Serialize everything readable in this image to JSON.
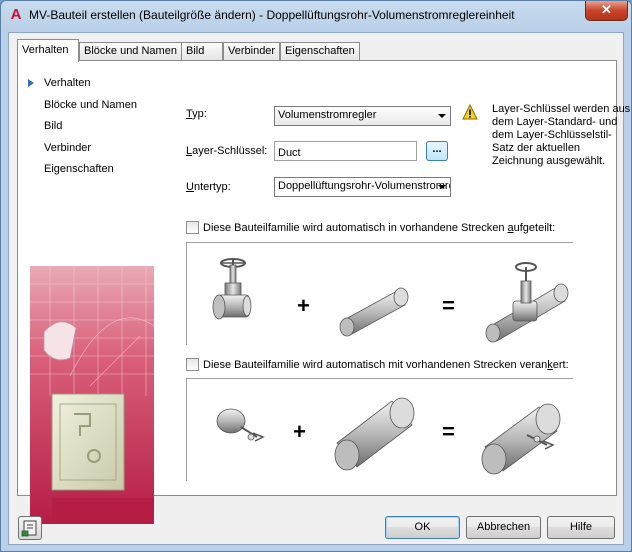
{
  "window": {
    "title": "MV-Bauteil erstellen (Bauteilgröße ändern) - Doppellüftungsrohr-Volumenstromreglereinheit",
    "close_label": "✕",
    "app_icon": "autocad-a-icon"
  },
  "tabs": [
    {
      "label": "Verhalten",
      "active": true
    },
    {
      "label": "Blöcke und Namen",
      "active": false
    },
    {
      "label": "Bild",
      "active": false
    },
    {
      "label": "Verbinder",
      "active": false
    },
    {
      "label": "Eigenschaften",
      "active": false
    }
  ],
  "nav": {
    "items": [
      {
        "label": "Verhalten",
        "current": true
      },
      {
        "label": "Blöcke und Namen",
        "current": false
      },
      {
        "label": "Bild",
        "current": false
      },
      {
        "label": "Verbinder",
        "current": false
      },
      {
        "label": "Eigenschaften",
        "current": false
      }
    ]
  },
  "form": {
    "typ_label_pre": "",
    "typ_label_mn": "T",
    "typ_label_post": "yp:",
    "typ_value": "Volumenstromregler",
    "layer_label_pre": "",
    "layer_label_mn": "L",
    "layer_label_post": "ayer-Schlüssel:",
    "layer_value": "Duct",
    "browse_label": "...",
    "untertyp_label_pre": "",
    "untertyp_label_mn": "U",
    "untertyp_label_post": "ntertyp:",
    "untertyp_value": "Doppellüftungsrohr-Volumenstromregler"
  },
  "info": {
    "icon": "warning-icon",
    "text": "Layer-Schlüssel werden aus dem Layer-Standard- und dem Layer-Schlüsselstil-Satz der aktuellen Zeichnung ausgewählt."
  },
  "options": {
    "split_pre": "Diese Bauteilfamilie wird automatisch in vorhandene Strecken ",
    "split_mn": "a",
    "split_post": "ufgeteilt:",
    "split_checked": false,
    "anchor_pre": "Diese Bauteilfamilie wird automatisch mit vorhandenen Strecken veran",
    "anchor_mn": "k",
    "anchor_post": "ert:",
    "anchor_checked": false
  },
  "equation": {
    "plus": "+",
    "equals": "="
  },
  "buttons": {
    "ok": "OK",
    "cancel": "Abbrechen",
    "help": "Hilfe"
  }
}
